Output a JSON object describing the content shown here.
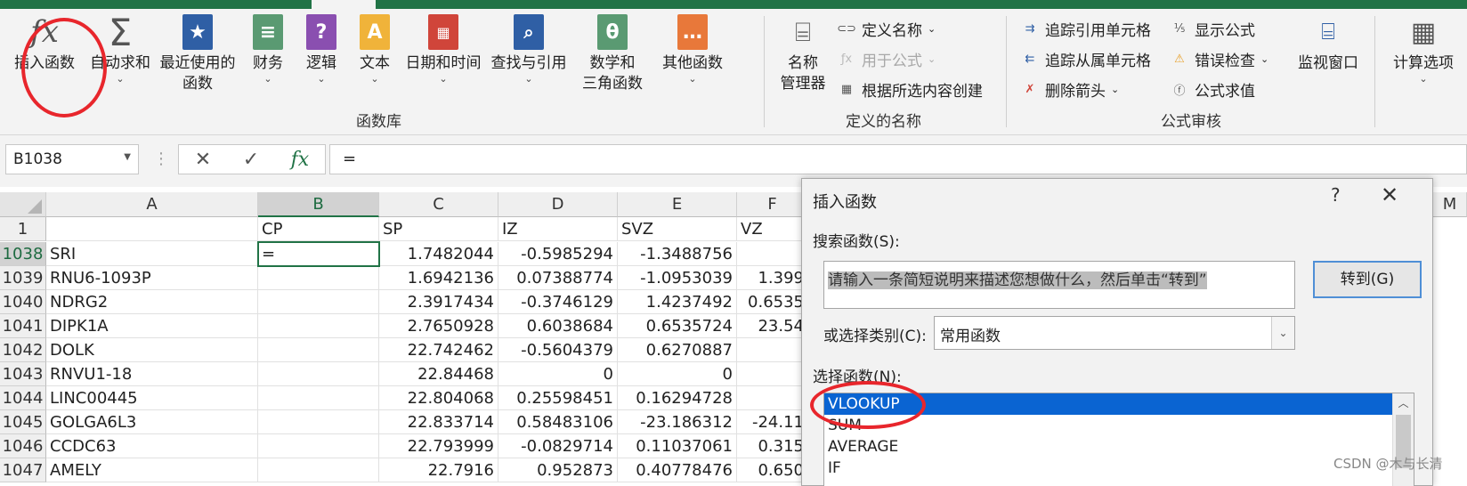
{
  "ribbon": {
    "function_library": {
      "insert_function": "插入函数",
      "autosum": "自动求和",
      "recently_used_1": "最近使用的",
      "recently_used_2": "函数",
      "financial": "财务",
      "logical": "逻辑",
      "text": "文本",
      "date_time": "日期和时间",
      "lookup_reference": "查找与引用",
      "math_trig_1": "数学和",
      "math_trig_2": "三角函数",
      "more_functions": "其他函数",
      "group_label": "函数库"
    },
    "defined_names": {
      "name_manager_1": "名称",
      "name_manager_2": "管理器",
      "define_name": "定义名称",
      "use_in_formula": "用于公式",
      "create_from_selection": "根据所选内容创建",
      "group_label": "定义的名称"
    },
    "formula_auditing": {
      "trace_precedents": "追踪引用单元格",
      "trace_dependents": "追踪从属单元格",
      "remove_arrows": "删除箭头",
      "show_formulas": "显示公式",
      "error_checking": "错误检查",
      "evaluate_formula": "公式求值",
      "watch_window": "监视窗口",
      "group_label": "公式审核"
    },
    "calculation": {
      "calc_options": "计算选项"
    },
    "colors": {
      "accent": "#217346",
      "annotation": "#e8262c"
    }
  },
  "formula_bar": {
    "name_box": "B1038",
    "cancel_symbol": "✕",
    "enter_symbol": "✓",
    "fx_symbol": "fx",
    "content": "="
  },
  "sheet": {
    "columns": [
      "A",
      "B",
      "C",
      "D",
      "E",
      "F",
      "M"
    ],
    "header_row_number": "1",
    "headers": [
      "",
      "CP",
      "SP",
      "IZ",
      "SVZ",
      "VZ"
    ],
    "rows": [
      {
        "n": "1038",
        "a": "SRI",
        "b": "=",
        "c": "1.7482044",
        "d": "-0.5985294",
        "e": "-1.3488756",
        "f": ""
      },
      {
        "n": "1039",
        "a": "RNU6-1093P",
        "b": "",
        "c": "1.6942136",
        "d": "0.07388774",
        "e": "-1.0953039",
        "f": "1.399"
      },
      {
        "n": "1040",
        "a": "NDRG2",
        "b": "",
        "c": "2.3917434",
        "d": "-0.3746129",
        "e": "1.4237492",
        "f": "0.6535"
      },
      {
        "n": "1041",
        "a": "DIPK1A",
        "b": "",
        "c": "2.7650928",
        "d": "0.6038684",
        "e": "0.6535724",
        "f": "23.54"
      },
      {
        "n": "1042",
        "a": "DOLK",
        "b": "",
        "c": "22.742462",
        "d": "-0.5604379",
        "e": "0.6270887",
        "f": ""
      },
      {
        "n": "1043",
        "a": "RNVU1-18",
        "b": "",
        "c": "22.84468",
        "d": "0",
        "e": "0",
        "f": ""
      },
      {
        "n": "1044",
        "a": "LINC00445",
        "b": "",
        "c": "22.804068",
        "d": "0.25598451",
        "e": "0.16294728",
        "f": ""
      },
      {
        "n": "1045",
        "a": "GOLGA6L3",
        "b": "",
        "c": "22.833714",
        "d": "0.58483106",
        "e": "-23.186312",
        "f": "-24.11"
      },
      {
        "n": "1046",
        "a": "CCDC63",
        "b": "",
        "c": "22.793999",
        "d": "-0.0829714",
        "e": "0.11037061",
        "f": "0.315"
      },
      {
        "n": "1047",
        "a": "AMELY",
        "b": "",
        "c": "22.7916",
        "d": "0.952873",
        "e": "0.40778476",
        "f": "0.650"
      }
    ]
  },
  "dialog": {
    "title": "插入函数",
    "help": "?",
    "close": "✕",
    "search_label": "搜索函数(S):",
    "search_value": "请输入一条简短说明来描述您想做什么，然后单击“转到”",
    "go_button": "转到(G)",
    "category_label": "或选择类别(C):",
    "category_value": "常用函数",
    "select_label": "选择函数(N):",
    "functions": [
      "VLOOKUP",
      "SUM",
      "AVERAGE",
      "IF"
    ]
  },
  "watermark": "CSDN @木与长清"
}
